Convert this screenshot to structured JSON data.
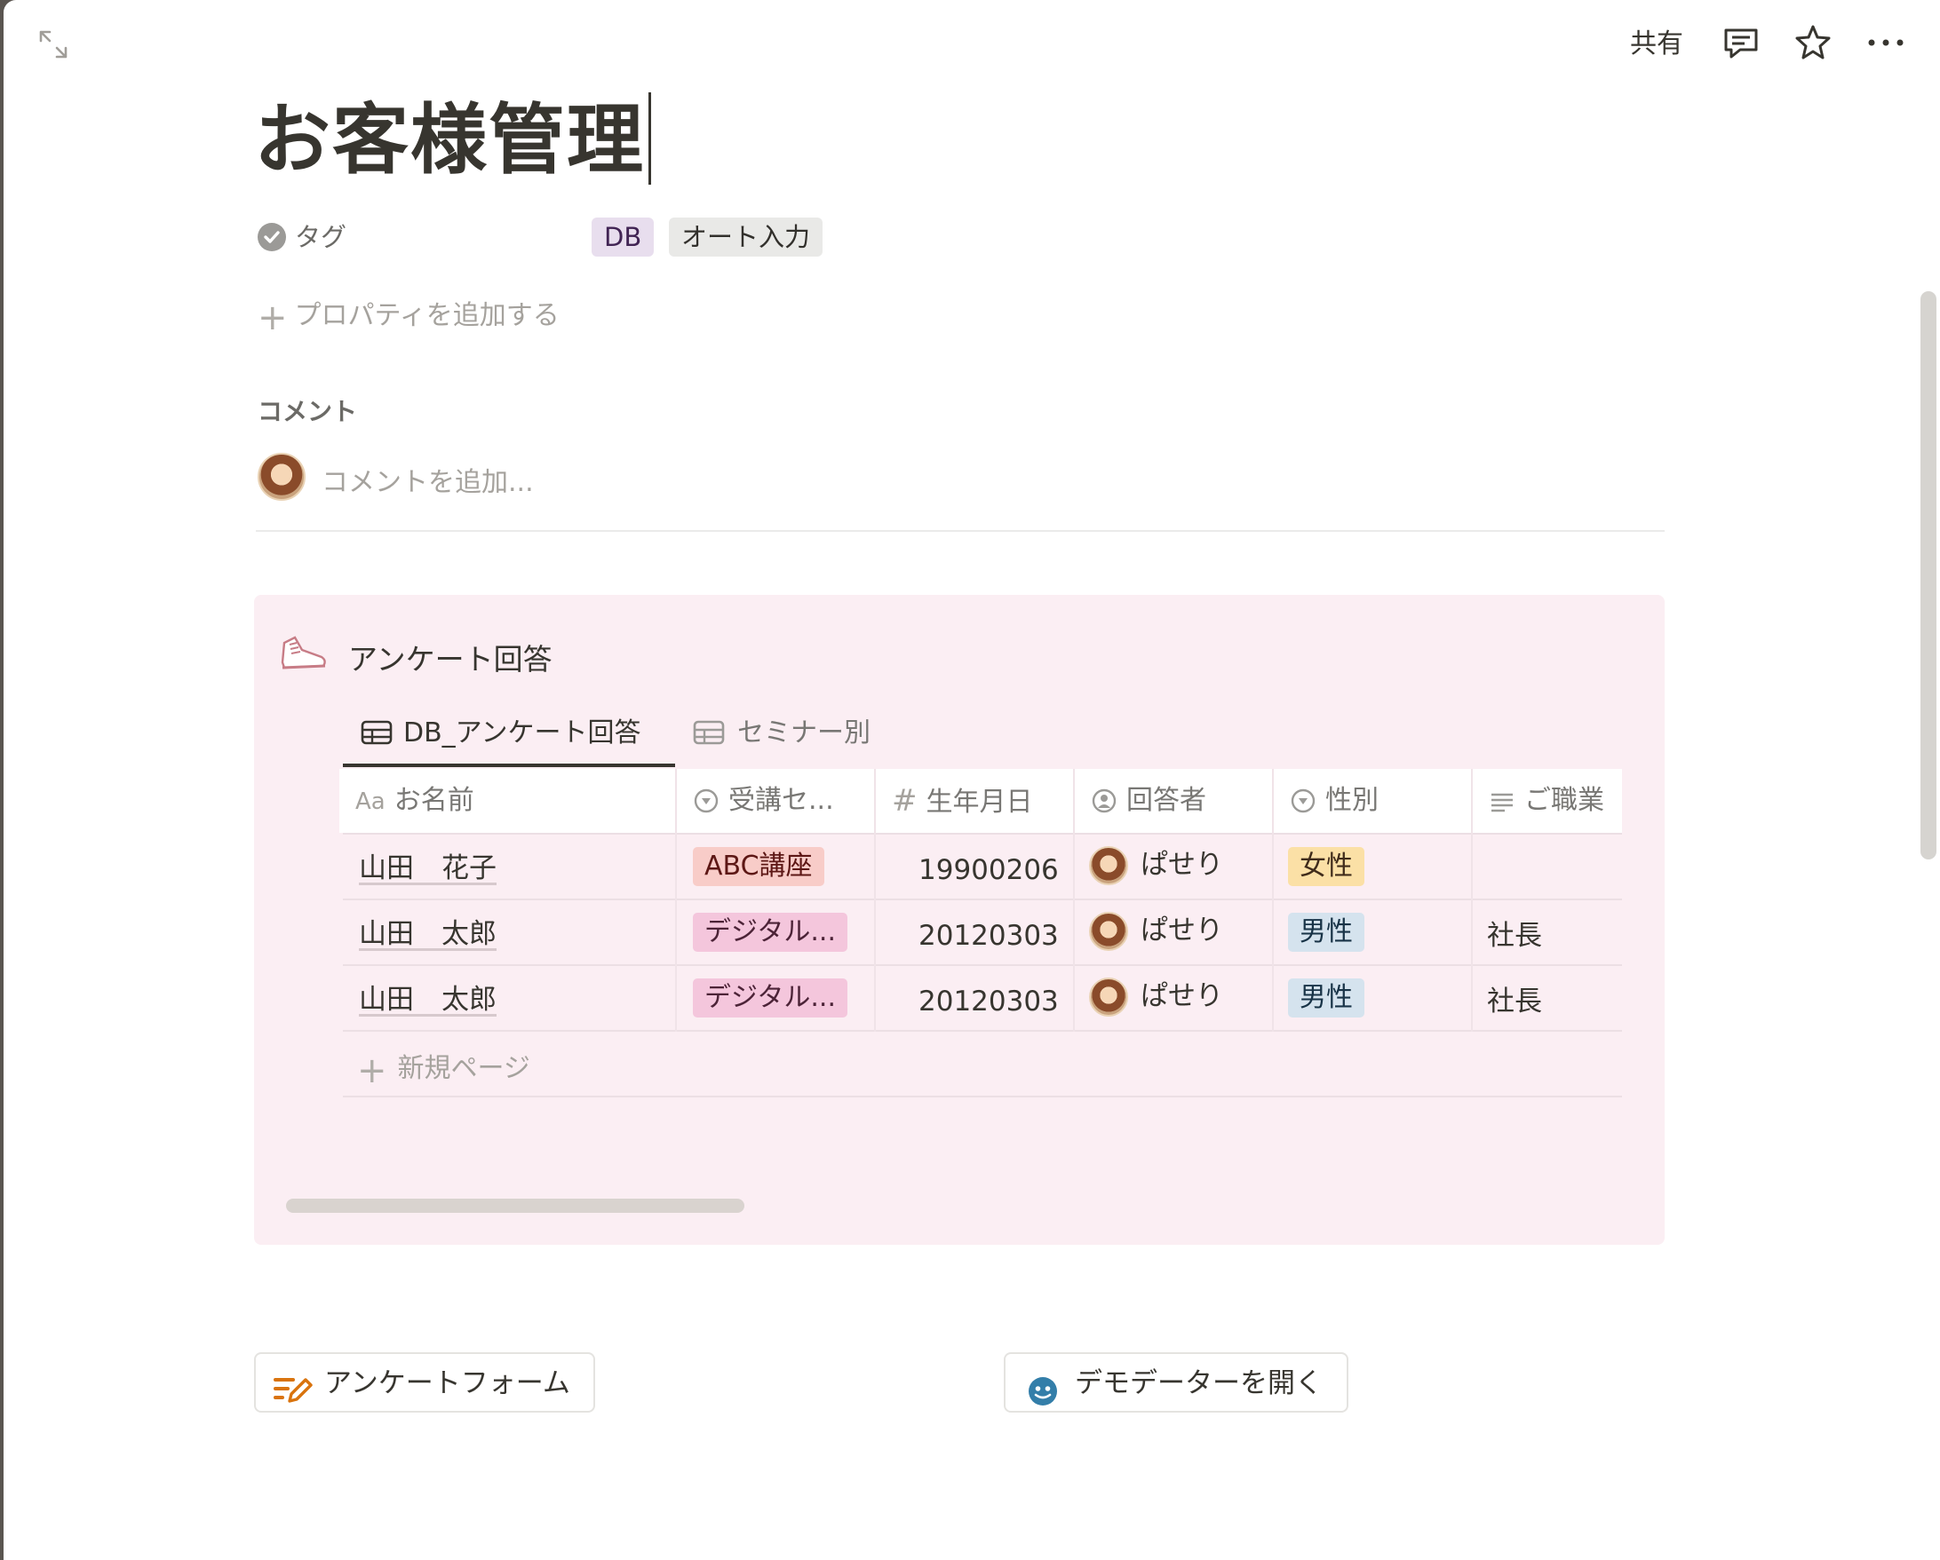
{
  "topbar": {
    "share_label": "共有",
    "comment_icon": "comment-icon",
    "favorite_icon": "star-icon",
    "more_icon": "more-icon",
    "expand_icon": "expand-icon"
  },
  "page": {
    "title": "お客様管理",
    "property": {
      "label": "タグ",
      "tags": [
        "DB",
        "オート入力"
      ]
    },
    "add_property_label": "プロパティを追加する",
    "comments_heading": "コメント",
    "comment_placeholder": "コメントを追加..."
  },
  "callout": {
    "icon": "sneaker-icon",
    "title": "アンケート回答",
    "tabs": [
      "DB_アンケート回答",
      "セミナー別"
    ],
    "active_tab": "DB_アンケート回答",
    "columns": [
      "お名前",
      "受講セ...",
      "生年月日",
      "回答者",
      "性別",
      "ご職業"
    ],
    "rows": [
      {
        "name": "山田　花子",
        "seminar": "ABC講座",
        "birth": "19900206",
        "respondent": "ぱせり",
        "gender": "女性",
        "job": ""
      },
      {
        "name": "山田　太郎",
        "seminar": "デジタル...",
        "birth": "20120303",
        "respondent": "ぱせり",
        "gender": "男性",
        "job": "社長"
      },
      {
        "name": "山田　太郎",
        "seminar": "デジタル...",
        "birth": "20120303",
        "respondent": "ぱせり",
        "gender": "男性",
        "job": "社長"
      }
    ],
    "new_page_label": "新規ページ"
  },
  "buttons": {
    "survey_form": "アンケートフォーム",
    "open_demo": "デモデーターを開く"
  },
  "colors": {
    "callout_bg": "#fbeef3",
    "tag_db_bg": "#e8deee",
    "pill_abc": "#f8ccc8",
    "pill_digital": "#f4c6dc",
    "pill_female": "#fbe0a6",
    "pill_male": "#d5e3ee",
    "form_icon": "#d9730d",
    "demo_icon": "#337ea9"
  }
}
